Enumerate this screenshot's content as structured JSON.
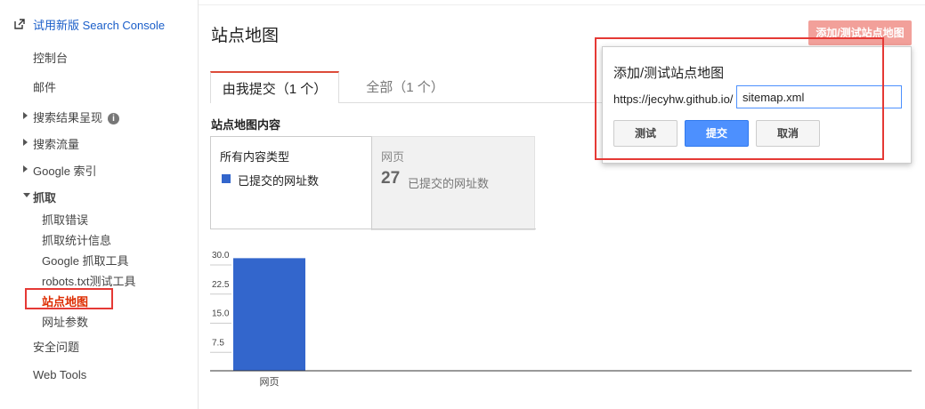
{
  "sidebar": {
    "try_new": "试用新版 Search Console",
    "items": {
      "dashboard": "控制台",
      "messages": "邮件",
      "search_appearance": "搜索结果呈现",
      "search_traffic": "搜索流量",
      "google_index": "Google 索引",
      "crawl": "抓取",
      "crawl_errors": "抓取错误",
      "crawl_stats": "抓取统计信息",
      "fetch_as_google": "Google 抓取工具",
      "robots_tester": "robots.txt测试工具",
      "sitemaps": "站点地图",
      "url_params": "网址参数",
      "security": "安全问题",
      "web_tools": "Web Tools"
    }
  },
  "main": {
    "title": "站点地图",
    "add_button": "添加/测试站点地图",
    "tabs": [
      {
        "label": "由我提交（1 个）",
        "active": true
      },
      {
        "label": "全部（1 个）",
        "active": false
      }
    ],
    "contents_heading": "站点地图内容",
    "panel_left": {
      "title": "所有内容类型",
      "legend": "已提交的网址数"
    },
    "panel_right": {
      "title": "网页",
      "count": "27",
      "count_label": "已提交的网址数"
    }
  },
  "dialog": {
    "title": "添加/测试站点地图",
    "url_prefix": "https://jecyhw.github.io/",
    "input_value": "sitemap.xml",
    "test": "测试",
    "submit": "提交",
    "cancel": "取消"
  },
  "chart_data": {
    "type": "bar",
    "categories": [
      "网页"
    ],
    "series": [
      {
        "values": [
          29
        ]
      }
    ],
    "y_ticks": [
      "30.0",
      "22.5",
      "15.0",
      "7.5"
    ],
    "ylim": [
      0,
      30
    ],
    "bar_color": "#3366cc"
  },
  "colors": {
    "accent": "#4d90fe",
    "highlight": "#e53935",
    "link": "#1a5ec9"
  }
}
